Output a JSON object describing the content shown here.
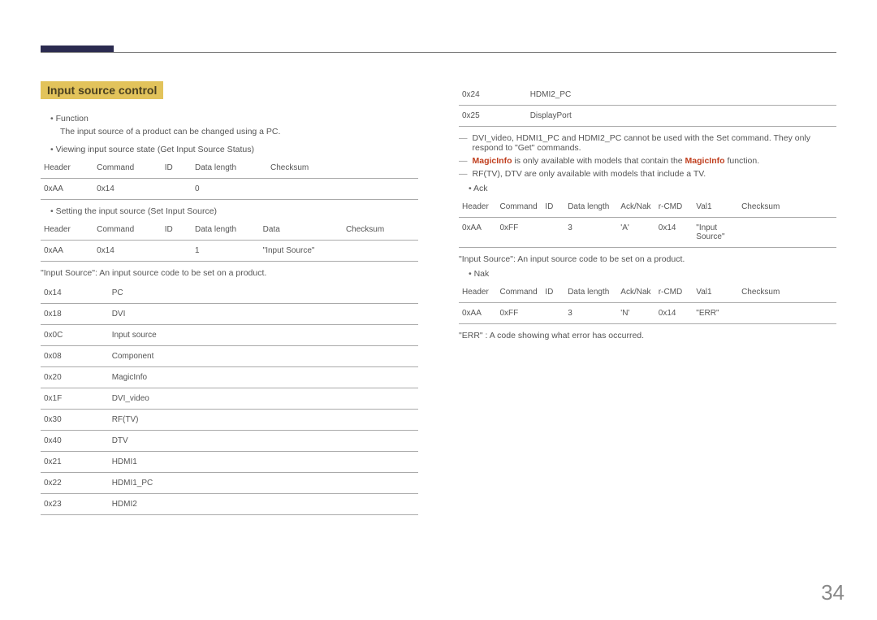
{
  "pageNumber": "34",
  "sectionTitle": "Input source control",
  "left": {
    "functionLabel": "Function",
    "functionDesc": "The input source of a product can be changed using a PC.",
    "viewLabel": "Viewing input source state (Get Input Source Status)",
    "getHeaders": [
      "Header",
      "Command",
      "ID",
      "Data length",
      "Checksum"
    ],
    "getRow": [
      "0xAA",
      "0x14",
      "",
      "0",
      ""
    ],
    "setLabel": "Setting the input source (Set Input Source)",
    "setHeaders": [
      "Header",
      "Command",
      "ID",
      "Data length",
      "Data",
      "Checksum"
    ],
    "setRow": [
      "0xAA",
      "0x14",
      "",
      "1",
      "\"Input Source\"",
      ""
    ],
    "codesCaption": "\"Input Source\": An input source code to be set on a product.",
    "codes": [
      [
        "0x14",
        "PC"
      ],
      [
        "0x18",
        "DVI"
      ],
      [
        "0x0C",
        "Input source"
      ],
      [
        "0x08",
        "Component"
      ],
      [
        "0x20",
        "MagicInfo"
      ],
      [
        "0x1F",
        "DVI_video"
      ],
      [
        "0x30",
        "RF(TV)"
      ],
      [
        "0x40",
        "DTV"
      ],
      [
        "0x21",
        "HDMI1"
      ],
      [
        "0x22",
        "HDMI1_PC"
      ],
      [
        "0x23",
        "HDMI2"
      ]
    ]
  },
  "right": {
    "codes": [
      [
        "0x24",
        "HDMI2_PC"
      ],
      [
        "0x25",
        "DisplayPort"
      ]
    ],
    "note1": "DVI_video, HDMI1_PC and HDMI2_PC cannot be used with the Set command. They only respond to \"Get\" commands.",
    "note2_pre": "MagicInfo",
    "note2_mid": " is only available with models that contain the ",
    "note2_bold": "MagicInfo",
    "note2_post": " function.",
    "note3": "RF(TV), DTV are only available with models that include a TV.",
    "ackLabel": "Ack",
    "ackHeaders": [
      "Header",
      "Command",
      "ID",
      "Data length",
      "Ack/Nak",
      "r-CMD",
      "Val1",
      "Checksum"
    ],
    "ackRow": [
      "0xAA",
      "0xFF",
      "",
      "3",
      "'A'",
      "0x14",
      "\"Input Source\"",
      ""
    ],
    "ackCaption": "\"Input Source\": An input source code to be set on a product.",
    "nakLabel": "Nak",
    "nakHeaders": [
      "Header",
      "Command",
      "ID",
      "Data length",
      "Ack/Nak",
      "r-CMD",
      "Val1",
      "Checksum"
    ],
    "nakRow": [
      "0xAA",
      "0xFF",
      "",
      "3",
      "'N'",
      "0x14",
      "\"ERR\"",
      ""
    ],
    "errCaption": "\"ERR\" : A code showing what error has occurred."
  }
}
